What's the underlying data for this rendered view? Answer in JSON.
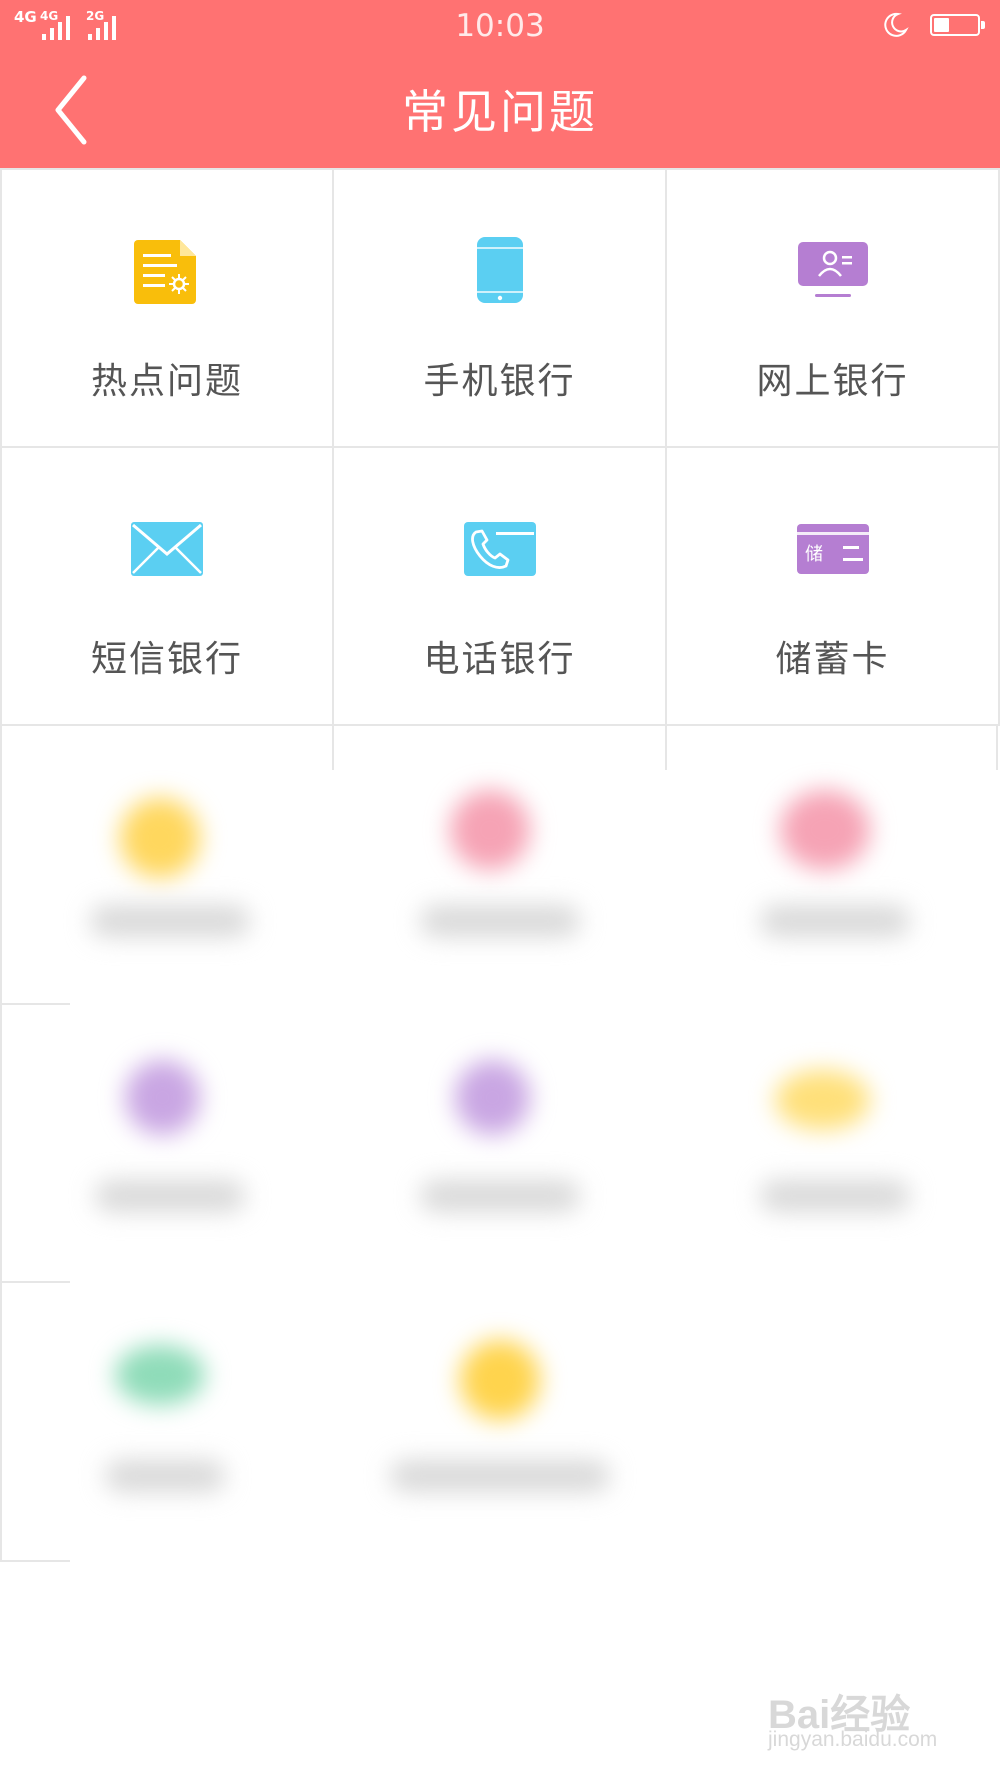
{
  "status_bar": {
    "network_1": "4G",
    "network_2": "4G",
    "network_3": "2G",
    "time": "10:03",
    "battery_level": 0.35,
    "night_mode_icon": "moon-icon"
  },
  "header": {
    "back_icon": "chevron-left-icon",
    "title": "常见问题",
    "background_color": "#ff7272"
  },
  "categories": [
    {
      "label": "热点问题",
      "icon": "hot-document-icon",
      "color": "#f9be0b"
    },
    {
      "label": "手机银行",
      "icon": "mobile-phone-icon",
      "color": "#5bcff2"
    },
    {
      "label": "网上银行",
      "icon": "online-banking-icon",
      "color": "#b57ed2"
    },
    {
      "label": "短信银行",
      "icon": "envelope-icon",
      "color": "#5bcff2"
    },
    {
      "label": "电话银行",
      "icon": "telephone-card-icon",
      "color": "#5bcff2"
    },
    {
      "label": "储蓄卡",
      "icon": "savings-card-icon",
      "color": "#b57ed2",
      "icon_text": "储"
    }
  ],
  "blurred_items": [
    {
      "color": "#ffd75e"
    },
    {
      "color": "#f6a3b5"
    },
    {
      "color": "#f6a3b5"
    },
    {
      "color": "#c9a6e3"
    },
    {
      "color": "#c9a6e3"
    },
    {
      "color": "#ffe07a"
    },
    {
      "color": "#8fdcb9"
    },
    {
      "color": "#ffd44d"
    }
  ],
  "watermark": {
    "line1": "Bai经验",
    "line2": "jingyan.baidu.com"
  }
}
